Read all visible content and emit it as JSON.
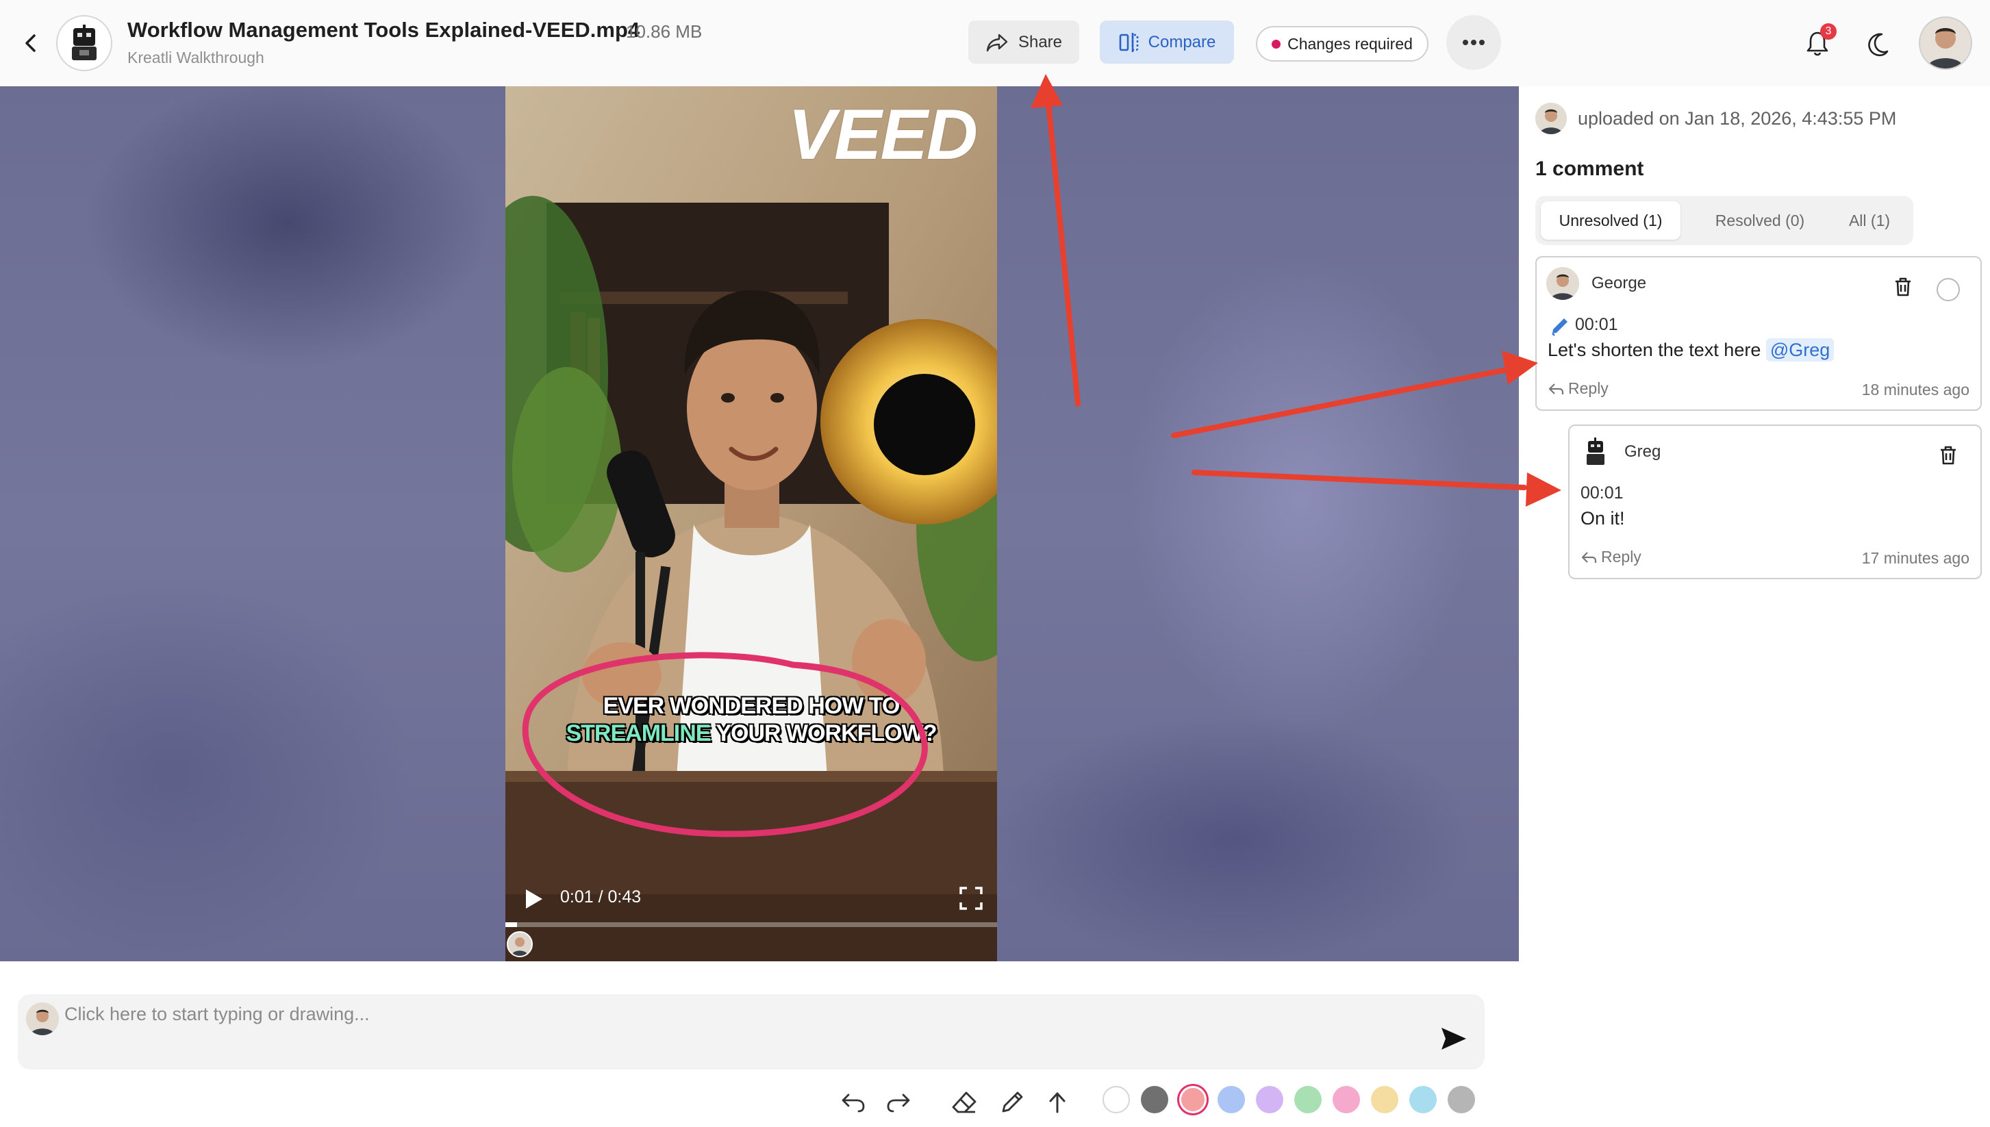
{
  "header": {
    "file_title": "Workflow Management Tools Explained-VEED.mp4",
    "file_size": "10.86 MB",
    "project_name": "Kreatli Walkthrough",
    "share_label": "Share",
    "compare_label": "Compare",
    "status_label": "Changes required",
    "notification_count": "3",
    "icons": [
      "back-chevron-icon",
      "share-icon",
      "compare-icon",
      "more-dots-icon",
      "bell-icon",
      "moon-icon"
    ]
  },
  "video": {
    "logo_text": "VEED",
    "caption_line1": "EVER WONDERED HOW TO",
    "caption_line2_highlight": "STREAMLINE",
    "caption_line2_rest": "YOUR WORKFLOW?",
    "current_time": "0:01",
    "time_separator": " / ",
    "duration": "0:43",
    "progress_fraction": 0.023,
    "annotation_color": "#e0336b"
  },
  "panel": {
    "uploaded_text": "uploaded on Jan 18, 2026, 4:43:55 PM",
    "comment_count": "1 comment",
    "tabs": [
      {
        "label": "Unresolved (1)",
        "active": true
      },
      {
        "label": "Resolved (0)",
        "active": false
      },
      {
        "label": "All (1)",
        "active": false
      }
    ],
    "comments": [
      {
        "author": "George",
        "timestamp": "00:01",
        "text": "Let's shorten the text here",
        "mention": "@Greg",
        "reply_label": "Reply",
        "ago": "18 minutes ago",
        "has_drawing": true
      },
      {
        "author": "Greg",
        "timestamp": "00:01",
        "text": "On it!",
        "reply_label": "Reply",
        "ago": "17 minutes ago"
      }
    ]
  },
  "composer": {
    "placeholder": "Click here to start typing or drawing..."
  },
  "drawing_tools": {
    "tools": [
      "undo-icon",
      "redo-icon",
      "eraser-icon",
      "pen-icon",
      "arrow-up-icon"
    ],
    "colors": [
      "#ffffff",
      "#707070",
      "#f4a0a0",
      "#a9c4f5",
      "#d3b5f5",
      "#a8e0b4",
      "#f5a9cd",
      "#f5dca0",
      "#a8dcef",
      "#b5b5b5"
    ],
    "selected_color": "#f4a0a0"
  },
  "overlay_arrow_color": "#e8402e"
}
